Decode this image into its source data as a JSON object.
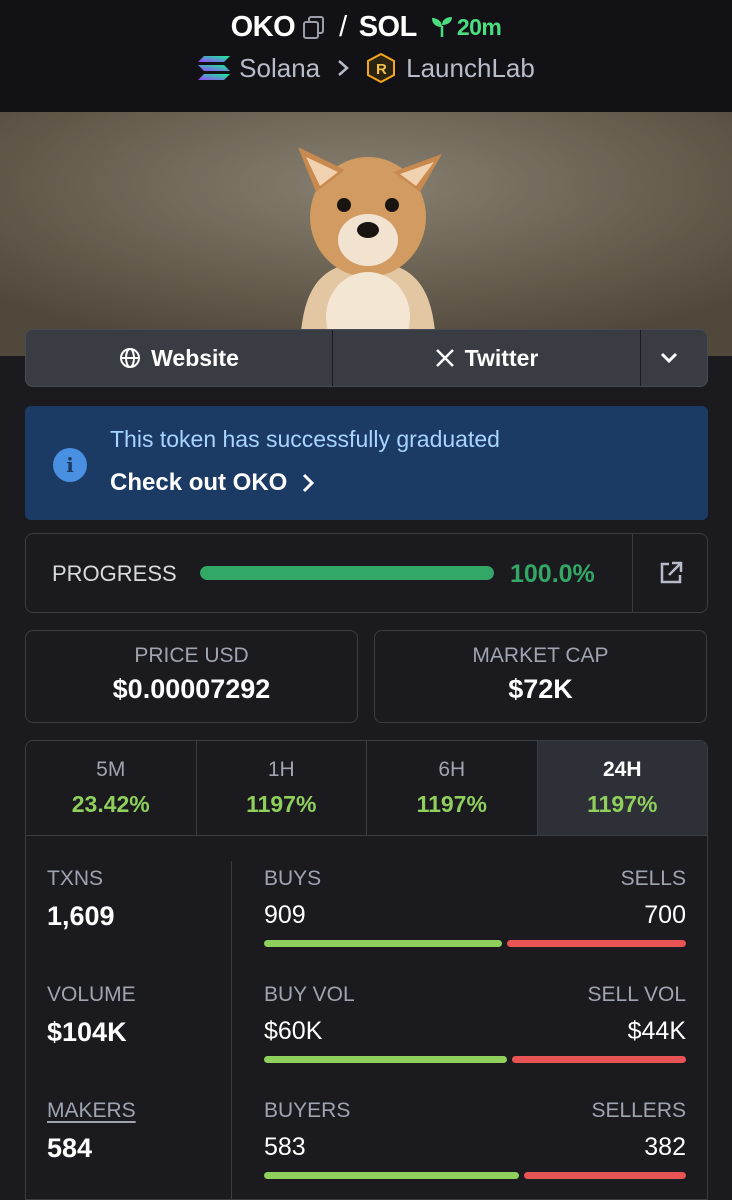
{
  "header": {
    "token": "OKO",
    "separator": "/",
    "quote": "SOL",
    "age": "20m",
    "chain": "Solana",
    "platform": "LaunchLab"
  },
  "links": {
    "website": "Website",
    "twitter": "Twitter"
  },
  "notice": {
    "message": "This token has successfully graduated",
    "cta": "Check out OKO"
  },
  "progress": {
    "label": "PROGRESS",
    "value_text": "100.0%",
    "fraction": 1.0
  },
  "stats": {
    "price_label": "PRICE USD",
    "price_value": "$0.00007292",
    "mcap_label": "MARKET CAP",
    "mcap_value": "$72K"
  },
  "periods": [
    {
      "name": "5M",
      "change": "23.42%"
    },
    {
      "name": "1H",
      "change": "1197%"
    },
    {
      "name": "6H",
      "change": "1197%"
    },
    {
      "name": "24H",
      "change": "1197%"
    }
  ],
  "metrics": {
    "txns_label": "TXNS",
    "txns_value": "1,609",
    "volume_label": "VOLUME",
    "volume_value": "$104K",
    "makers_label": "MAKERS",
    "makers_value": "584",
    "buys_label": "BUYS",
    "sells_label": "SELLS",
    "buys": "909",
    "sells": "700",
    "buys_fraction": 0.565,
    "buyvol_label": "BUY VOL",
    "sellvol_label": "SELL VOL",
    "buyvol": "$60K",
    "sellvol": "$44K",
    "buyvol_fraction": 0.577,
    "buyers_label": "BUYERS",
    "sellers_label": "SELLERS",
    "buyers": "583",
    "sellers": "382",
    "buyers_fraction": 0.604
  },
  "colors": {
    "accent_green": "#33a866",
    "positive": "#8fd05c",
    "negative": "#e85454",
    "notice_bg": "#1b3a64"
  }
}
